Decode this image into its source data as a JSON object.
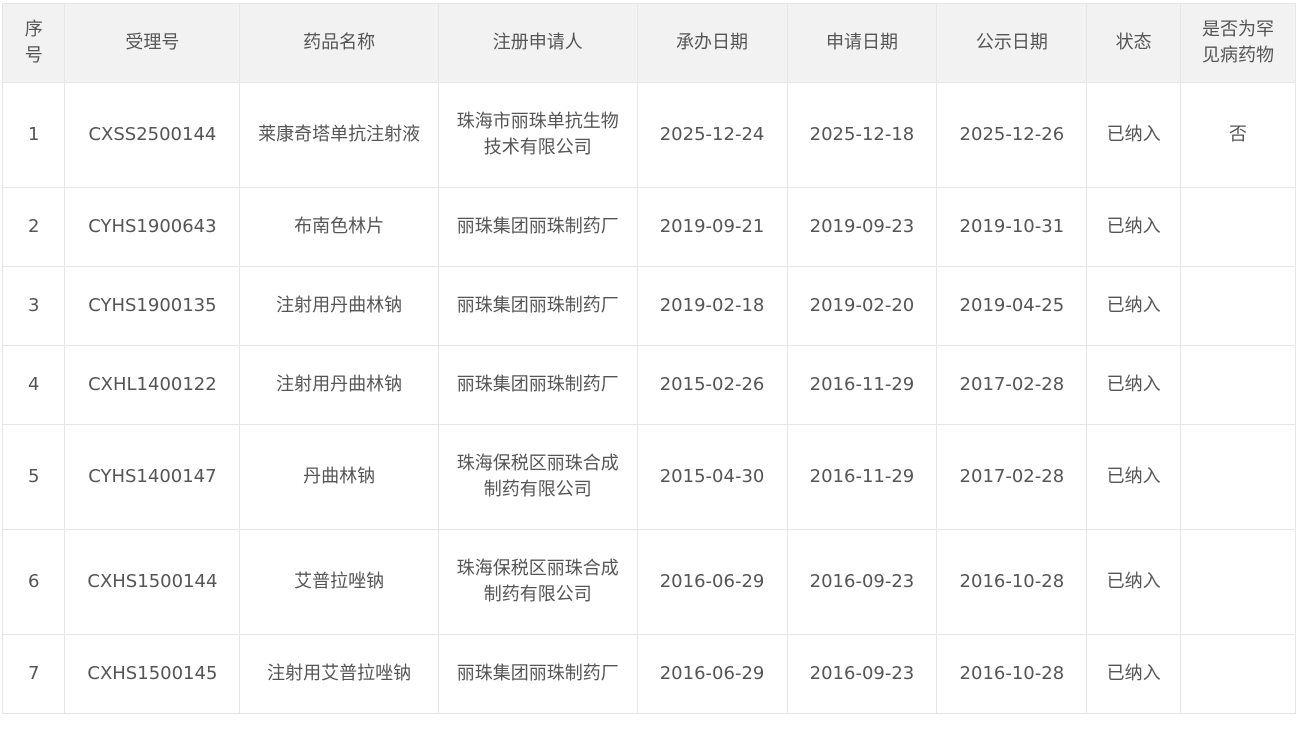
{
  "table": {
    "headers": {
      "index": "序号",
      "accept_no": "受理号",
      "drug_name": "药品名称",
      "applicant": "注册申请人",
      "undertake_date": "承办日期",
      "apply_date": "申请日期",
      "publish_date": "公示日期",
      "status": "状态",
      "rare_disease": "是否为罕见病药物"
    },
    "rows": [
      {
        "index": "1",
        "accept_no": "CXSS2500144",
        "drug_name": "莱康奇塔单抗注射液",
        "applicant": "珠海市丽珠单抗生物技术有限公司",
        "undertake_date": "2025-12-24",
        "apply_date": "2025-12-18",
        "publish_date": "2025-12-26",
        "status": "已纳入",
        "rare_disease": "否"
      },
      {
        "index": "2",
        "accept_no": "CYHS1900643",
        "drug_name": "布南色林片",
        "applicant": "丽珠集团丽珠制药厂",
        "undertake_date": "2019-09-21",
        "apply_date": "2019-09-23",
        "publish_date": "2019-10-31",
        "status": "已纳入",
        "rare_disease": ""
      },
      {
        "index": "3",
        "accept_no": "CYHS1900135",
        "drug_name": "注射用丹曲林钠",
        "applicant": "丽珠集团丽珠制药厂",
        "undertake_date": "2019-02-18",
        "apply_date": "2019-02-20",
        "publish_date": "2019-04-25",
        "status": "已纳入",
        "rare_disease": ""
      },
      {
        "index": "4",
        "accept_no": "CXHL1400122",
        "drug_name": "注射用丹曲林钠",
        "applicant": "丽珠集团丽珠制药厂",
        "undertake_date": "2015-02-26",
        "apply_date": "2016-11-29",
        "publish_date": "2017-02-28",
        "status": "已纳入",
        "rare_disease": ""
      },
      {
        "index": "5",
        "accept_no": "CYHS1400147",
        "drug_name": "丹曲林钠",
        "applicant": "珠海保税区丽珠合成制药有限公司",
        "undertake_date": "2015-04-30",
        "apply_date": "2016-11-29",
        "publish_date": "2017-02-28",
        "status": "已纳入",
        "rare_disease": ""
      },
      {
        "index": "6",
        "accept_no": "CXHS1500144",
        "drug_name": "艾普拉唑钠",
        "applicant": "珠海保税区丽珠合成制药有限公司",
        "undertake_date": "2016-06-29",
        "apply_date": "2016-09-23",
        "publish_date": "2016-10-28",
        "status": "已纳入",
        "rare_disease": ""
      },
      {
        "index": "7",
        "accept_no": "CXHS1500145",
        "drug_name": "注射用艾普拉唑钠",
        "applicant": "丽珠集团丽珠制药厂",
        "undertake_date": "2016-06-29",
        "apply_date": "2016-09-23",
        "publish_date": "2016-10-28",
        "status": "已纳入",
        "rare_disease": ""
      }
    ]
  }
}
